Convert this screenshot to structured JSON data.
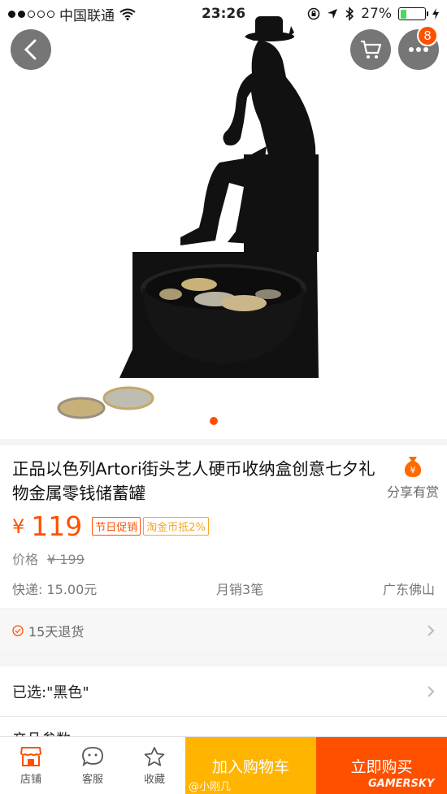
{
  "status_bar": {
    "carrier": "中国联通",
    "time": "23:26",
    "battery": "27%"
  },
  "hero": {
    "cart_badge": "8"
  },
  "product": {
    "title": "正品以色列Artori街头艺人硬币收纳盒创意七夕礼物金属零钱储蓄罐",
    "share_label": "分享有赏",
    "currency": "¥",
    "price": "119",
    "tags": [
      "节日促销",
      "淘金币抵2%"
    ],
    "orig_label": "价格",
    "orig_price": "¥ 199",
    "shipping": "快递: 15.00元",
    "monthly_sales": "月销3笔",
    "location": "广东佛山"
  },
  "service": {
    "return_policy": "15天退货"
  },
  "selection": {
    "selected_text": "已选:\"黑色\"",
    "params_text": "产品参数"
  },
  "bottom_bar": {
    "store_label": "店铺",
    "service_label": "客服",
    "favorite_label": "收藏",
    "add_cart_label": "加入购物车",
    "buy_now_label": "立即购买"
  },
  "watermark": {
    "weibo": "@小刚几",
    "site": "GAMERSKY"
  },
  "colors": {
    "accent": "#ff5000",
    "add_cart": "#ffb400"
  }
}
